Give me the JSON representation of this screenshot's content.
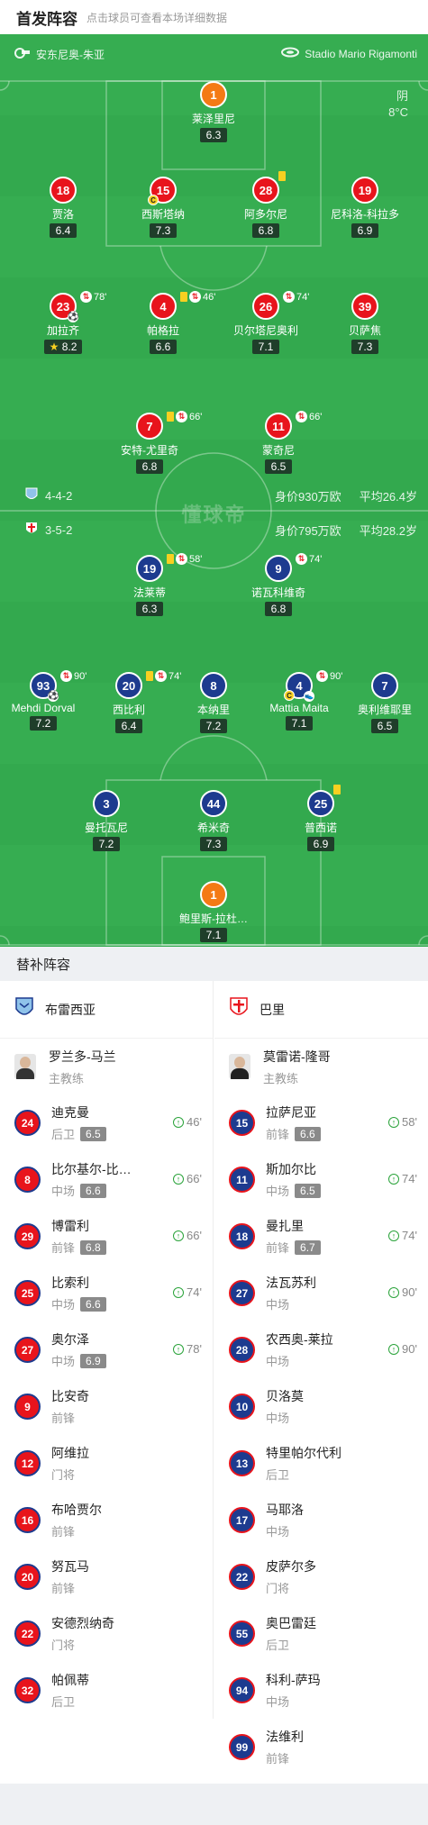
{
  "header": {
    "title": "首发阵容",
    "subtitle": "点击球员可查看本场详细数据"
  },
  "pitch": {
    "referee": "安东尼奥-朱亚",
    "stadium": "Stadio Mario Rigamonti",
    "weather": "阴",
    "temperature": "8°C",
    "watermark": "懂球帝",
    "home_formation": "4-4-2",
    "home_value": "身价930万欧",
    "home_age": "平均26.4岁",
    "away_formation": "3-5-2",
    "away_value": "身价795万欧",
    "away_age": "平均28.2岁"
  },
  "home_players": [
    {
      "num": "1",
      "name": "莱泽里尼",
      "rating": "6.3"
    },
    {
      "num": "18",
      "name": "贾洛",
      "rating": "6.4"
    },
    {
      "num": "15",
      "name": "西斯塔纳",
      "rating": "7.3",
      "cap": "C"
    },
    {
      "num": "28",
      "name": "阿多尔尼",
      "rating": "6.8"
    },
    {
      "num": "19",
      "name": "尼科洛-科拉多",
      "rating": "6.9"
    },
    {
      "num": "23",
      "name": "加拉齐",
      "rating": "8.2",
      "event": "78'"
    },
    {
      "num": "4",
      "name": "帕格拉",
      "rating": "6.6",
      "event": "46'"
    },
    {
      "num": "26",
      "name": "贝尔塔尼奥利",
      "rating": "7.1",
      "event": "74'"
    },
    {
      "num": "39",
      "name": "贝萨焦",
      "rating": "7.3"
    },
    {
      "num": "7",
      "name": "安特-尤里奇",
      "rating": "6.8",
      "event": "66'"
    },
    {
      "num": "11",
      "name": "蒙奇尼",
      "rating": "6.5",
      "event": "66'"
    }
  ],
  "away_players": [
    {
      "num": "19",
      "name": "法莱蒂",
      "rating": "6.3",
      "event": "58'"
    },
    {
      "num": "9",
      "name": "诺瓦科维奇",
      "rating": "6.8",
      "event": "74'"
    },
    {
      "num": "93",
      "name": "Mehdi Dorval",
      "rating": "7.2",
      "event": "90'"
    },
    {
      "num": "20",
      "name": "西比利",
      "rating": "6.4",
      "event": "74'"
    },
    {
      "num": "8",
      "name": "本纳里",
      "rating": "7.2"
    },
    {
      "num": "4",
      "name": "Mattia Maita",
      "rating": "7.1",
      "event": "90'",
      "cap": "C"
    },
    {
      "num": "7",
      "name": "奥利维耶里",
      "rating": "6.5"
    },
    {
      "num": "3",
      "name": "曼托瓦尼",
      "rating": "7.2"
    },
    {
      "num": "44",
      "name": "希米奇",
      "rating": "7.3"
    },
    {
      "num": "25",
      "name": "普西诺",
      "rating": "6.9"
    },
    {
      "num": "1",
      "name": "鲍里斯-拉杜…",
      "rating": "7.1"
    }
  ],
  "subs": {
    "title": "替补阵容",
    "home_team": "布雷西亚",
    "away_team": "巴里",
    "home_coach": {
      "name": "罗兰多-马兰",
      "role": "主教练"
    },
    "away_coach": {
      "name": "莫雷诺-隆哥",
      "role": "主教练"
    },
    "home": [
      {
        "num": "24",
        "name": "迪克曼",
        "pos": "后卫",
        "rating": "6.5",
        "min": "46'"
      },
      {
        "num": "8",
        "name": "比尔基尔-比…",
        "pos": "中场",
        "rating": "6.6",
        "min": "66'"
      },
      {
        "num": "29",
        "name": "博雷利",
        "pos": "前锋",
        "rating": "6.8",
        "min": "66'"
      },
      {
        "num": "25",
        "name": "比索利",
        "pos": "中场",
        "rating": "6.6",
        "min": "74'"
      },
      {
        "num": "27",
        "name": "奥尔泽",
        "pos": "中场",
        "rating": "6.9",
        "min": "78'"
      },
      {
        "num": "9",
        "name": "比安奇",
        "pos": "前锋"
      },
      {
        "num": "12",
        "name": "阿维拉",
        "pos": "门将"
      },
      {
        "num": "16",
        "name": "布哈贾尔",
        "pos": "前锋"
      },
      {
        "num": "20",
        "name": "努瓦马",
        "pos": "前锋"
      },
      {
        "num": "22",
        "name": "安德烈纳奇",
        "pos": "门将"
      },
      {
        "num": "32",
        "name": "帕佩蒂",
        "pos": "后卫"
      }
    ],
    "away": [
      {
        "num": "15",
        "name": "拉萨尼亚",
        "pos": "前锋",
        "rating": "6.6",
        "min": "58'"
      },
      {
        "num": "11",
        "name": "斯加尔比",
        "pos": "中场",
        "rating": "6.5",
        "min": "74'"
      },
      {
        "num": "18",
        "name": "曼扎里",
        "pos": "前锋",
        "rating": "6.7",
        "min": "74'"
      },
      {
        "num": "27",
        "name": "法瓦苏利",
        "pos": "中场",
        "min": "90'"
      },
      {
        "num": "28",
        "name": "农西奥-莱拉",
        "pos": "中场",
        "min": "90'"
      },
      {
        "num": "10",
        "name": "贝洛莫",
        "pos": "中场"
      },
      {
        "num": "13",
        "name": "特里帕尔代利",
        "pos": "后卫"
      },
      {
        "num": "17",
        "name": "马耶洛",
        "pos": "中场"
      },
      {
        "num": "22",
        "name": "皮萨尔多",
        "pos": "门将"
      },
      {
        "num": "55",
        "name": "奥巴雷廷",
        "pos": "后卫"
      },
      {
        "num": "94",
        "name": "科利-萨玛",
        "pos": "中场"
      },
      {
        "num": "99",
        "name": "法维利",
        "pos": "前锋"
      }
    ]
  }
}
